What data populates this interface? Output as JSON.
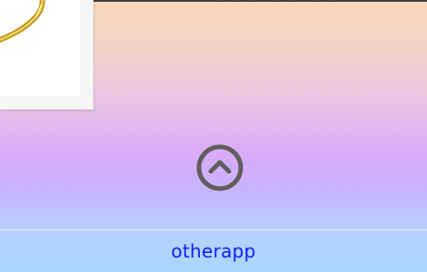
{
  "thumbnail": {
    "icon": "gold-ring-image"
  },
  "scroll_top": {
    "icon": "chevron-up-circle-icon",
    "color": "#5f5f5f"
  },
  "footer": {
    "link_text": "otherapp",
    "link_color": "#0a1cff"
  },
  "colors": {
    "gradient_top": "#f8d7b8",
    "gradient_mid": "#dcaaf7",
    "gradient_bottom": "#a8d8ff"
  }
}
